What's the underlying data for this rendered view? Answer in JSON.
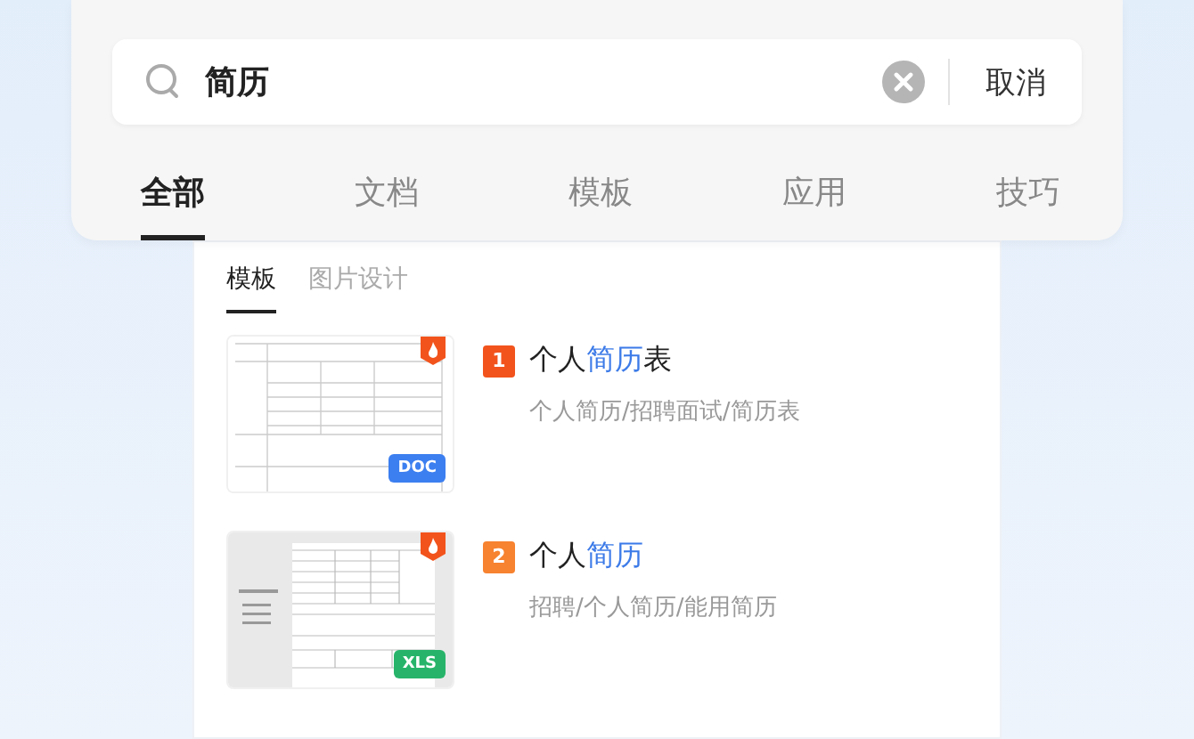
{
  "search": {
    "value": "简历",
    "cancel": "取消"
  },
  "tabs": [
    {
      "label": "全部",
      "selected": true
    },
    {
      "label": "文档",
      "selected": false
    },
    {
      "label": "模板",
      "selected": false
    },
    {
      "label": "应用",
      "selected": false
    },
    {
      "label": "技巧",
      "selected": false
    }
  ],
  "subtabs": [
    {
      "label": "模板",
      "selected": true
    },
    {
      "label": "图片设计",
      "selected": false
    }
  ],
  "results": [
    {
      "rank": "1",
      "color": "#f2531c",
      "hot": true,
      "format": "DOC",
      "kind": "doc",
      "title": [
        {
          "text": "个人",
          "highlight": false
        },
        {
          "text": "简历",
          "highlight": true
        },
        {
          "text": "表",
          "highlight": false
        }
      ],
      "tags": "个人简历/招聘面试/简历表"
    },
    {
      "rank": "2",
      "color": "#f7822f",
      "hot": true,
      "format": "XLS",
      "kind": "xls",
      "title": [
        {
          "text": "个人",
          "highlight": false
        },
        {
          "text": "简历",
          "highlight": true
        }
      ],
      "tags": "招聘/个人简历/能用简历"
    }
  ]
}
